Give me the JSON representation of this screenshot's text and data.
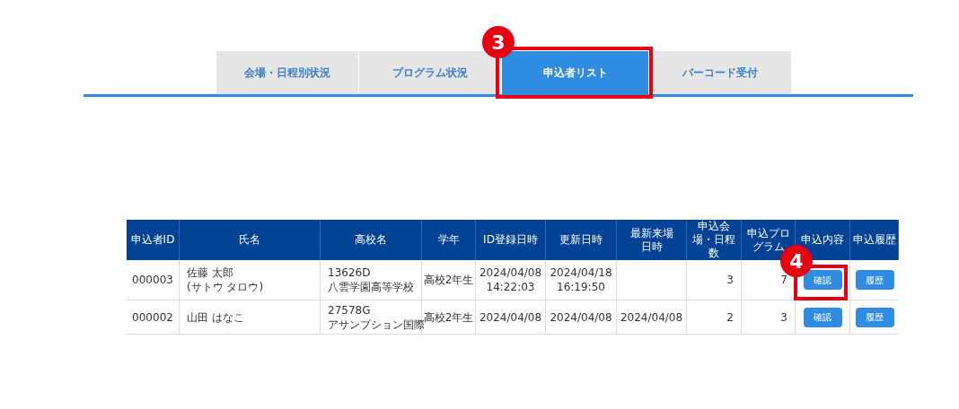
{
  "tabs": [
    {
      "label": "会場・日程別状況",
      "selected": false
    },
    {
      "label": "プログラム状況",
      "selected": false
    },
    {
      "label": "申込者リスト",
      "selected": true
    },
    {
      "label": "バーコード受付",
      "selected": false
    }
  ],
  "tab_callout": "3",
  "table": {
    "columns": [
      "申込者ID",
      "氏名",
      "高校名",
      "学年",
      "ID登録日時",
      "更新日時",
      "最新来場日時",
      "申込会場・日程数",
      "申込プログラム",
      "申込内容",
      "申込履歴"
    ],
    "rows": [
      {
        "cells": [
          [
            "000003"
          ],
          [
            "佐藤 太郎",
            "(サトウ タロウ)"
          ],
          [
            "13626D",
            "八雲学園高等学校"
          ],
          [
            "高校2年生"
          ],
          [
            "2024/04/08",
            "14:22:03"
          ],
          [
            "2024/04/18",
            "16:19:50"
          ],
          [],
          [
            "3"
          ],
          [
            "7"
          ]
        ],
        "confirm": "確認",
        "history": "履歴"
      },
      {
        "cells": [
          [
            "000002"
          ],
          [
            "山田 はなこ"
          ],
          [
            "27578G",
            "アサンプション国際"
          ],
          [
            "高校2年生"
          ],
          [
            "2024/04/08"
          ],
          [
            "2024/04/08"
          ],
          [
            "2024/04/08"
          ],
          [
            "2"
          ],
          [
            "3"
          ]
        ],
        "confirm": "確認",
        "history": "履歴"
      }
    ]
  },
  "button_callout": "4"
}
